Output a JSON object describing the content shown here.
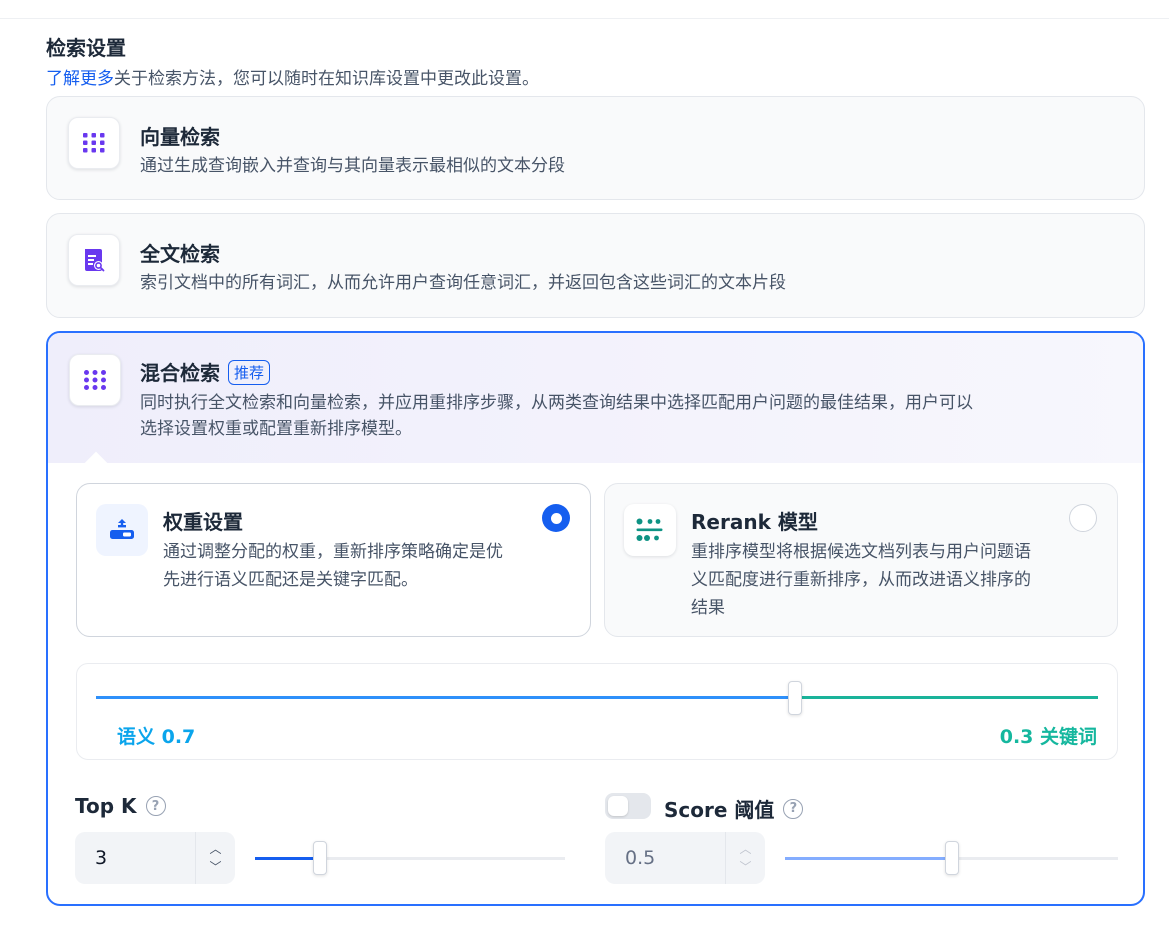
{
  "header": {
    "title": "检索设置",
    "link": "了解更多",
    "desc": "关于检索方法，您可以随时在知识库设置中更改此设置。"
  },
  "methods": [
    {
      "title": "向量检索",
      "desc": "通过生成查询嵌入并查询与其向量表示最相似的文本分段",
      "icon": "grid-dots-icon"
    },
    {
      "title": "全文检索",
      "desc": "索引文档中的所有词汇，从而允许用户查询任意词汇，并返回包含这些词汇的文本片段",
      "icon": "document-search-icon"
    },
    {
      "title": "混合检索",
      "badge": "推荐",
      "desc_line1": "同时执行全文检索和向量检索，并应用重排序步骤，从两类查询结果中选择匹配用户问题的最佳结果，用户可以",
      "desc_line2": "选择设置权重或配置重新排序模型。",
      "icon": "grid-dots-icon"
    }
  ],
  "hybrid": {
    "options": [
      {
        "title": "权重设置",
        "desc_line1": "通过调整分配的权重，重新排序策略确定是优",
        "desc_line2": "先进行语义匹配还是关键字匹配。",
        "selected": true,
        "icon": "balance-icon"
      },
      {
        "title": "Rerank 模型",
        "desc_line1": "重排序模型将根据候选文档列表与用户问题语",
        "desc_line2": "义匹配度进行重新排序，从而改进语义排序的",
        "desc_line3": "结果",
        "selected": false,
        "icon": "rerank-icon"
      }
    ],
    "weights": {
      "semantic_label": "语义 0.7",
      "keyword_label": "0.3 关键词",
      "semantic": 0.7,
      "keyword": 0.3
    },
    "top_k": {
      "label": "Top K",
      "value": "3",
      "slider_fraction": 0.21
    },
    "score_threshold": {
      "label": "Score 阈值",
      "value": "0.5",
      "enabled": false,
      "slider_fraction": 0.5
    }
  },
  "colors": {
    "accent": "#155eef",
    "semantic": "#0ba5ec",
    "keyword": "#15b79e",
    "icon_purple": "#6938ef"
  }
}
